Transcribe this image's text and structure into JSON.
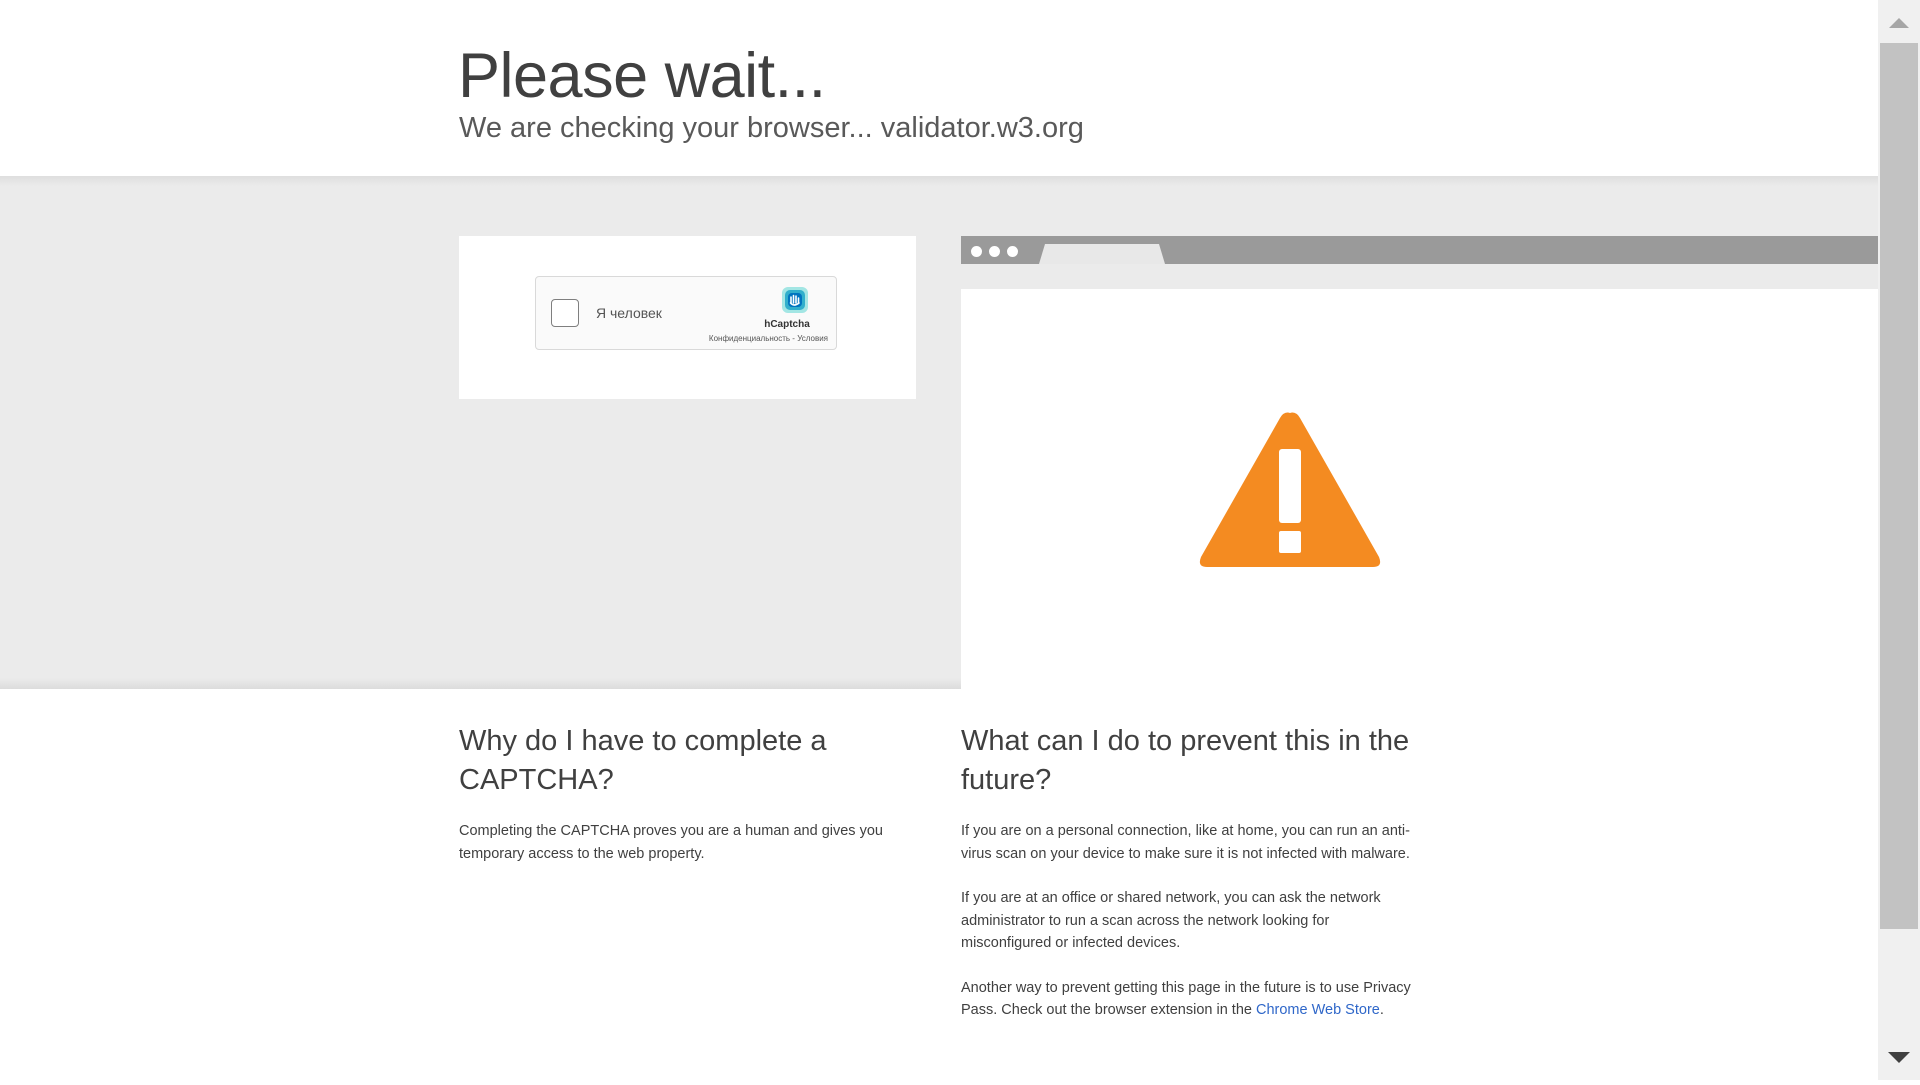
{
  "header": {
    "title": "Please wait...",
    "subtitle": "We are checking your browser... validator.w3.org"
  },
  "captcha": {
    "checkbox_label": "Я человек",
    "brand": "hCaptcha",
    "privacy_link": "Конфиденциальность",
    "separator": " - ",
    "terms_link": "Условия",
    "logo_icon": "hcaptcha-hand-icon",
    "brand_color": "#0074bf",
    "accent_color": "#00bfbb"
  },
  "illustration": {
    "icon": "warning-triangle-icon",
    "warning_color": "#f48b21"
  },
  "why": {
    "title": "Why do I have to complete a CAPTCHA?",
    "text": "Completing the CAPTCHA proves you are a human and gives you temporary access to the web property."
  },
  "prevent": {
    "title": "What can I do to prevent this in the future?",
    "paragraph1": "If you are on a personal connection, like at home, you can run an anti-virus scan on your device to make sure it is not infected with malware.",
    "paragraph2": "If you are at an office or shared network, you can ask the network administrator to run a scan across the network looking for misconfigured or infected devices.",
    "paragraph3_prefix": "Another way to prevent getting this page in the future is to use Privacy Pass. Check out the browser extension in the ",
    "paragraph3_link": "Chrome Web Store",
    "paragraph3_suffix": "."
  },
  "colors": {
    "link": "#2f67c9",
    "band": "#ebebeb",
    "text": "#404040"
  }
}
